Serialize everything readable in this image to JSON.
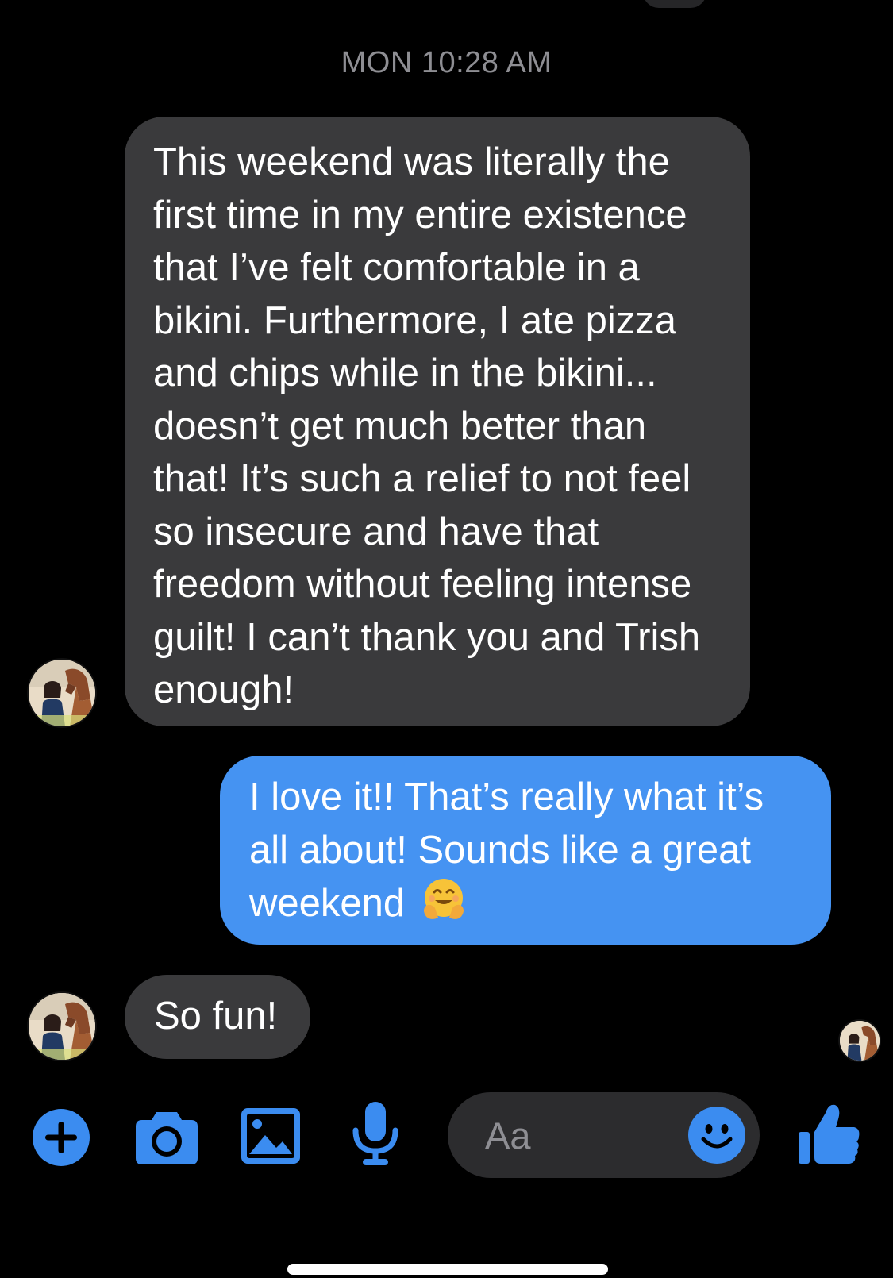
{
  "conversation": {
    "timestamp": "MON 10:28 AM",
    "messages": [
      {
        "direction": "incoming",
        "text": "This weekend was literally the first time in my entire existence that I’ve felt comfortable in a bikini. Furthermore, I ate pizza and chips while in the bikini... doesn’t get much better than that! It’s such a relief to not feel so insecure and have that freedom without feeling intense guilt! I can’t thank you and Trish enough!"
      },
      {
        "direction": "outgoing",
        "text": "I love it!! That’s really what it’s all about! Sounds like a great weekend",
        "emoji": "hugging-face-icon"
      },
      {
        "direction": "incoming",
        "text": "So fun!"
      }
    ]
  },
  "composer": {
    "placeholder": "Aa",
    "icons": [
      "plus-icon",
      "camera-icon",
      "image-icon",
      "microphone-icon",
      "smiley-icon",
      "thumbs-up-icon"
    ]
  },
  "colors": {
    "background": "#000000",
    "incoming_bubble": "#3a3a3c",
    "outgoing_bubble": "#4593f2",
    "accent": "#3b8cf0",
    "timestamp": "#8e8e93",
    "composer_field": "#2c2c2e"
  }
}
